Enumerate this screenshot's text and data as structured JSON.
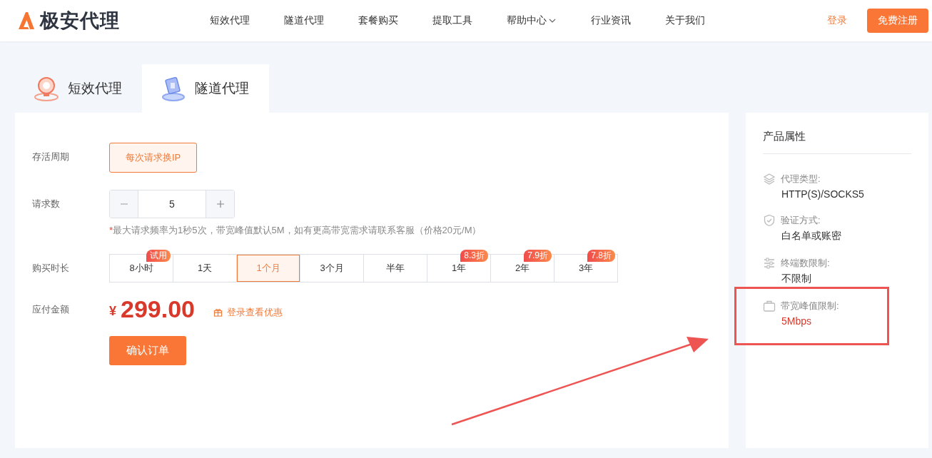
{
  "header": {
    "logo_text": "极安代理",
    "nav": [
      {
        "label": "短效代理",
        "dropdown": false
      },
      {
        "label": "隧道代理",
        "dropdown": false
      },
      {
        "label": "套餐购买",
        "dropdown": false
      },
      {
        "label": "提取工具",
        "dropdown": false
      },
      {
        "label": "帮助中心",
        "dropdown": true
      },
      {
        "label": "行业资讯",
        "dropdown": false
      },
      {
        "label": "关于我们",
        "dropdown": false
      }
    ],
    "login": "登录",
    "register": "免费注册"
  },
  "tabs": [
    {
      "label": "短效代理",
      "selected": false,
      "kind": "short"
    },
    {
      "label": "隧道代理",
      "selected": true,
      "kind": "tunnel"
    }
  ],
  "form": {
    "lifetime": {
      "label": "存活周期",
      "option": "每次请求换IP"
    },
    "requests": {
      "label": "请求数",
      "value": "5",
      "note_mark": "*",
      "note": "最大请求频率为1秒5次，带宽峰值默认5M，如有更高带宽需求请联系客服（价格20元/M）"
    },
    "duration": {
      "label": "购买时长",
      "options": [
        {
          "label": "8小时",
          "selected": false,
          "badge": "试用"
        },
        {
          "label": "1天",
          "selected": false
        },
        {
          "label": "1个月",
          "selected": true
        },
        {
          "label": "3个月",
          "selected": false
        },
        {
          "label": "半年",
          "selected": false
        },
        {
          "label": "1年",
          "selected": false,
          "badge": "8.3折"
        },
        {
          "label": "2年",
          "selected": false,
          "badge": "7.9折"
        },
        {
          "label": "3年",
          "selected": false,
          "badge": "7.8折"
        }
      ]
    },
    "amount": {
      "label": "应付金额",
      "currency": "¥",
      "price": "299.00",
      "discount_link": "登录查看优惠"
    },
    "submit": "确认订单"
  },
  "attributes": {
    "title": "产品属性",
    "items": [
      {
        "kind": "layers",
        "label": "代理类型:",
        "value": "HTTP(S)/SOCKS5",
        "highlighted": false
      },
      {
        "kind": "shield",
        "label": "验证方式:",
        "value": "白名单或账密",
        "highlighted": false
      },
      {
        "kind": "sliders",
        "label": "终端数限制:",
        "value": "不限制",
        "highlighted": false
      },
      {
        "kind": "case",
        "label": "带宽峰值限制:",
        "value": "5Mbps",
        "highlighted": true
      }
    ]
  }
}
